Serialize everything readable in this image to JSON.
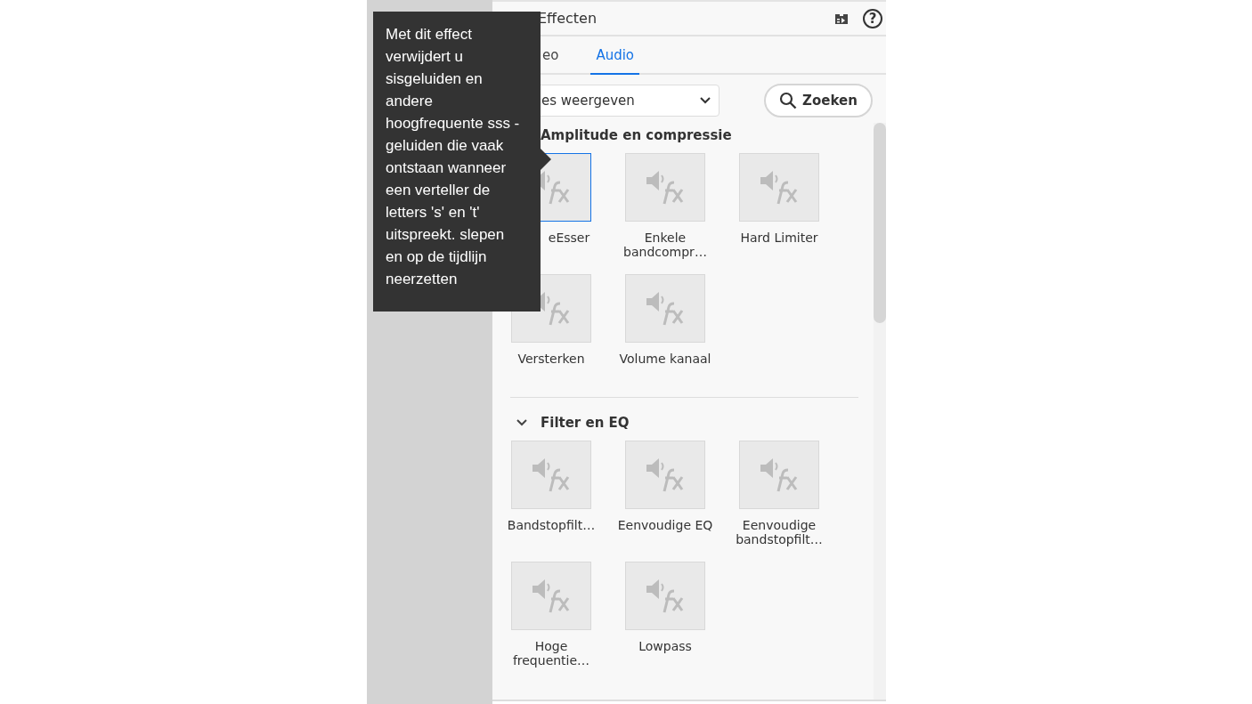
{
  "panel": {
    "title": "Effecten",
    "help": "?"
  },
  "tabs": [
    {
      "label": "eo",
      "selected": false
    },
    {
      "label": "Audio",
      "selected": true
    }
  ],
  "filter": {
    "value": "es weergeven"
  },
  "search": {
    "label": "Zoeken"
  },
  "sections": [
    {
      "title": "Amplitude en compressie",
      "expanded": true,
      "chevron_visible": false,
      "effects": [
        {
          "name": "eEsser",
          "selected": true
        },
        {
          "name": "Enkele bandcompr…",
          "selected": false
        },
        {
          "name": "Hard Limiter",
          "selected": false
        },
        {
          "name": "Versterken",
          "selected": false
        },
        {
          "name": "Volume kanaal",
          "selected": false
        }
      ]
    },
    {
      "title": "Filter en EQ",
      "expanded": true,
      "chevron_visible": true,
      "effects": [
        {
          "name": "Bandstopfilt…",
          "selected": false
        },
        {
          "name": "Eenvoudige EQ",
          "selected": false
        },
        {
          "name": "Eenvoudige bandstopfilt…",
          "selected": false
        },
        {
          "name": "Hoge frequentie…",
          "selected": false
        },
        {
          "name": "Lowpass",
          "selected": false
        }
      ]
    }
  ],
  "tooltip": {
    "text": "Met dit effect verwijdert u sisgeluiden en andere hoogfrequente sss -geluiden die vaak ontstaan wanneer een verteller de letters 's' en 't' uitspreekt. slepen en op de tijdlijn neerzetten"
  }
}
